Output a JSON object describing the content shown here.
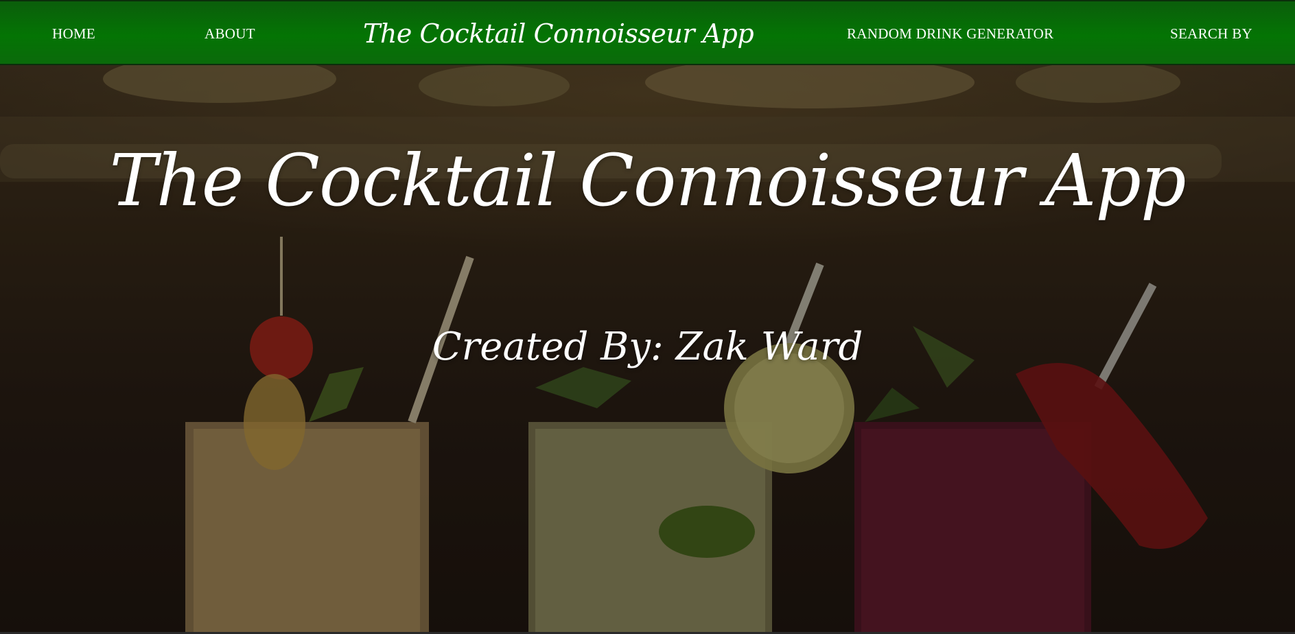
{
  "nav": {
    "home": "HOME",
    "about": "ABOUT",
    "title": "The Cocktail Connoisseur App",
    "random": "RANDOM DRINK GENERATOR",
    "search": "SEARCH BY"
  },
  "hero": {
    "title": "The Cocktail Connoisseur App",
    "subtitle": "Created By: Zak Ward",
    "image": "cocktails-background-image"
  },
  "colors": {
    "nav_green": "#047404",
    "text": "#ffffff"
  }
}
